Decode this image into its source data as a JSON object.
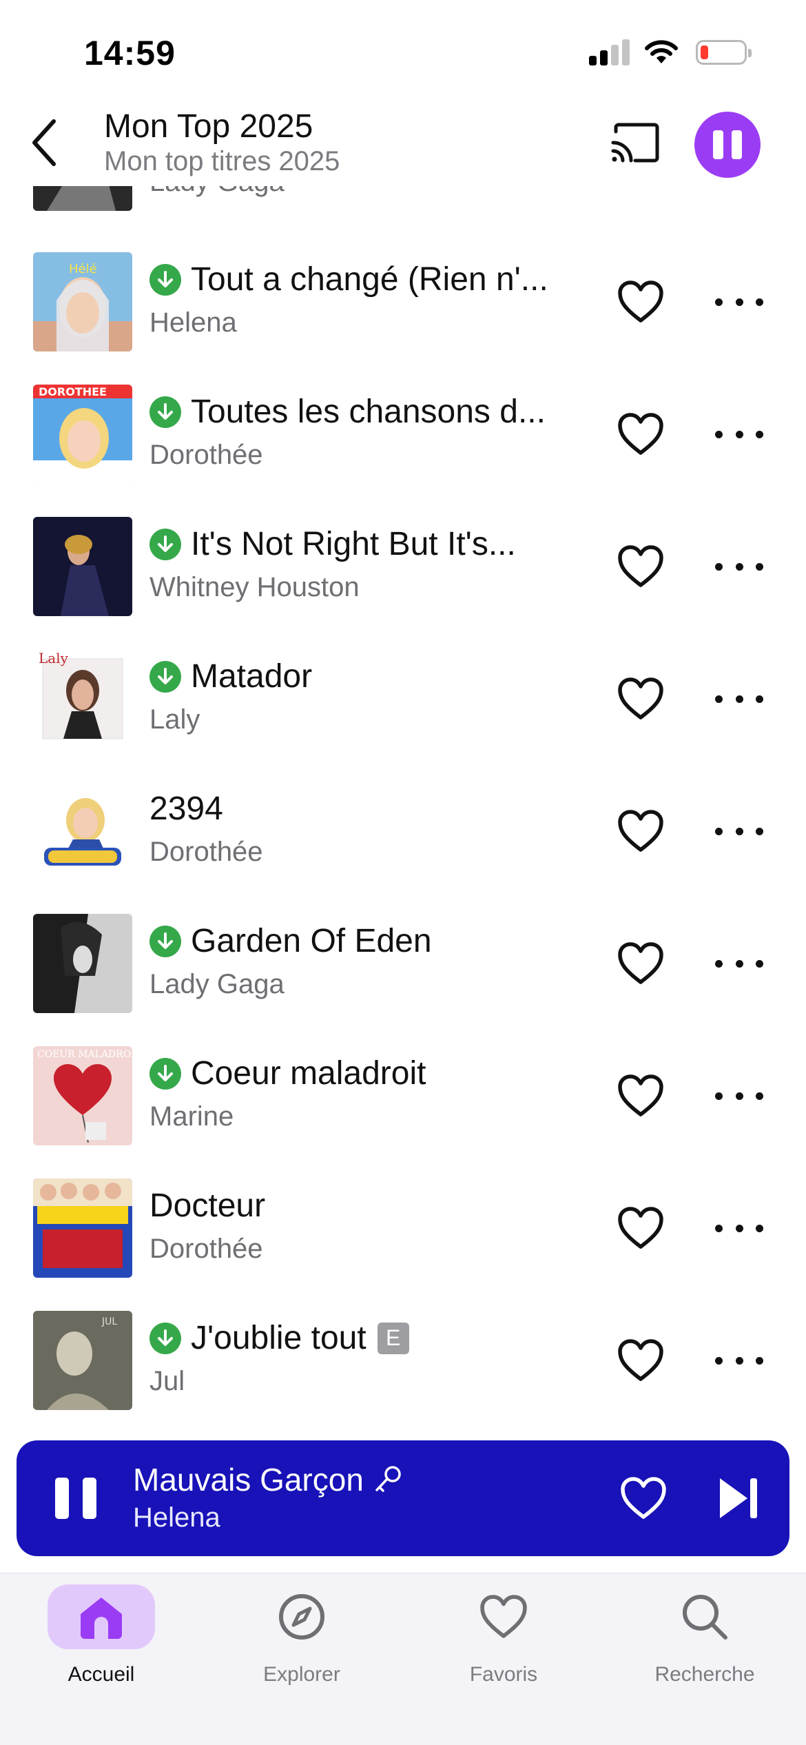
{
  "status_bar": {
    "time": "14:59"
  },
  "header": {
    "title": "Mon Top 2025",
    "subtitle": "Mon top titres 2025"
  },
  "partial_row": {
    "artist": "Lady Gaga"
  },
  "tracks": [
    {
      "title": "Tout a changé (Rien n'...",
      "artist": "Helena",
      "downloaded": true,
      "explicit": false
    },
    {
      "title": "Toutes les chansons d...",
      "artist": "Dorothée",
      "downloaded": true,
      "explicit": false
    },
    {
      "title": "It's Not Right But It's...",
      "artist": "Whitney Houston",
      "downloaded": true,
      "explicit": false
    },
    {
      "title": "Matador",
      "artist": "Laly",
      "downloaded": true,
      "explicit": false
    },
    {
      "title": "2394",
      "artist": "Dorothée",
      "downloaded": false,
      "explicit": false
    },
    {
      "title": "Garden Of Eden",
      "artist": "Lady Gaga",
      "downloaded": true,
      "explicit": false
    },
    {
      "title": "Coeur maladroit",
      "artist": "Marine",
      "downloaded": true,
      "explicit": false
    },
    {
      "title": "Docteur",
      "artist": "Dorothée",
      "downloaded": false,
      "explicit": false
    },
    {
      "title": "J'oublie tout",
      "artist": "Jul",
      "downloaded": true,
      "explicit": true,
      "explicit_label": "E"
    }
  ],
  "player": {
    "title": "Mauvais Garçon",
    "artist": "Helena"
  },
  "tabs": [
    {
      "label": "Accueil",
      "icon": "home-icon",
      "active": true
    },
    {
      "label": "Explorer",
      "icon": "compass-icon",
      "active": false
    },
    {
      "label": "Favoris",
      "icon": "heart-icon",
      "active": false
    },
    {
      "label": "Recherche",
      "icon": "search-icon",
      "active": false
    }
  ],
  "colors": {
    "accent": "#9b3cf5",
    "player_bg": "#1812b8",
    "download": "#35a84a",
    "tab_active_bg": "#e2c9fb"
  }
}
